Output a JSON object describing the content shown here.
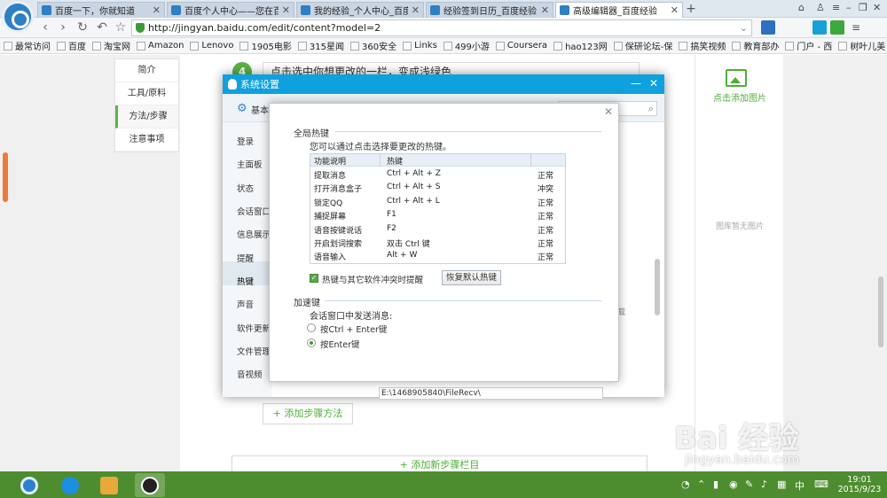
{
  "browser": {
    "tabs": [
      {
        "label": "百度一下，你就知道",
        "active": false
      },
      {
        "label": "百度个人中心——您在百度",
        "active": false
      },
      {
        "label": "我的经验_个人中心_百度经验",
        "active": false
      },
      {
        "label": "经验签到日历_百度经验",
        "active": false
      },
      {
        "label": "高级编辑器_百度经验",
        "active": true
      }
    ],
    "new_tab": "+",
    "url": "http://jingyan.baidu.com/edit/content?model=2",
    "bookmarks": [
      "最常访问",
      "百度",
      "淘宝网",
      "Amazon",
      "Lenovo",
      "1905电影",
      "315星闻",
      "360安全",
      "Links",
      "499小游",
      "Coursera",
      "hao123网",
      "保研论坛-保",
      "搞笑视频",
      "教育部办",
      "门户 - 西",
      "树叶儿美"
    ],
    "more_bookmarks": "»"
  },
  "editor": {
    "left_nav": [
      "简介",
      "工具/原料",
      "方法/步骤",
      "注意事项"
    ],
    "active_nav": "方法/步骤",
    "step_number": "4",
    "step_text": "点击选中你想更改的一栏，变成浅绿色",
    "add_step_method": "+ 添加步骤方法",
    "add_new_section": "+ 添加新步骤栏目",
    "add_image": "点击添加图片",
    "no_image": "图库暂无图片"
  },
  "qq_settings": {
    "title": "系统设置",
    "toolbar_label": "基本",
    "sidebar": [
      "登录",
      "主面板",
      "状态",
      "会话窗口",
      "信息展示",
      "提醒",
      "热键",
      "声音",
      "软件更新",
      "文件管理",
      "音视频"
    ],
    "active_sidebar": "热键",
    "file_path": "E:\\1468905840\\FileRecv\\"
  },
  "hotkey_dialog": {
    "global_section": "全局热键",
    "description": "您可以通过点击选择要更改的热键。",
    "columns": [
      "功能说明",
      "热键",
      ""
    ],
    "rows": [
      {
        "function": "提取消息",
        "hotkey": "Ctrl + Alt + Z",
        "status": "正常"
      },
      {
        "function": "打开消息盒子",
        "hotkey": "Ctrl + Alt + S",
        "status": "冲突"
      },
      {
        "function": "锁定QQ",
        "hotkey": "Ctrl + Alt + L",
        "status": "正常"
      },
      {
        "function": "捕捉屏幕",
        "hotkey": "F1",
        "status": "正常"
      },
      {
        "function": "语音按键说话",
        "hotkey": "F2",
        "status": "正常"
      },
      {
        "function": "开启划词搜索",
        "hotkey": "双击 Ctrl 键",
        "status": "正常"
      },
      {
        "function": "语音输入",
        "hotkey": "Alt + W",
        "status": "正常"
      }
    ],
    "conflict_checkbox": "热键与其它软件冲突时提醒",
    "restore_button": "恢复默认热键",
    "accel_section": "加速键",
    "send_label": "会话窗口中发送消息:",
    "option_ctrl_enter": "按Ctrl + Enter键",
    "option_enter": "按Enter键",
    "selected_option": "enter"
  },
  "taskbar": {
    "ime": "中",
    "time": "19:01",
    "date": "2015/9/23"
  },
  "watermark": {
    "brand": "Bai 经验",
    "url": "jingyan.baidu.com"
  },
  "colors": {
    "qq_blue": "#0fa1de",
    "baidu_green": "#4fae3a",
    "taskbar": "#4d8d2f"
  }
}
